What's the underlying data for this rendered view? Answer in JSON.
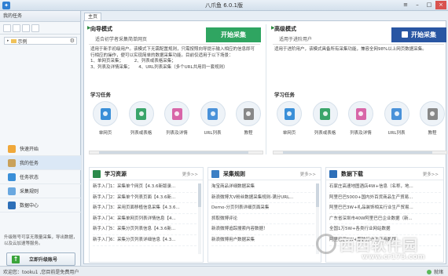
{
  "window": {
    "title": "八爪鱼 6.0.1版"
  },
  "sidebar": {
    "header": "我的任务",
    "tree_item": "示例",
    "nav": [
      {
        "label": "快速开始",
        "color": "#f0a83a"
      },
      {
        "label": "我的任务",
        "color": "#c9a15a"
      },
      {
        "label": "任务状态",
        "color": "#3a8fd8"
      },
      {
        "label": "采集规则",
        "color": "#6aa8e0"
      },
      {
        "label": "数据中心",
        "color": "#2d6fb8"
      }
    ],
    "note": "升级账号可享无限量采集，导出数据，以及云加速等服务。",
    "upgrade_label": "立即升级账号"
  },
  "tabs": {
    "home": "主页"
  },
  "guide": {
    "title": "向导模式",
    "subtitle": "适合初学者采集简单网页",
    "start": "开始采集",
    "desc_lines": [
      "适用于新手初级用户。该模式下无需配置规则，只需按照向导提示输入相应的信息即可",
      "行相应的操作，便可以实现简单的数据采集功能。目前仅适用于以下场景：",
      "1、单网页采集；　　　2、列表或表格采集；",
      "3、列表及详情采集；　　4、URL列表采集（多个URL共用同一套规则）"
    ],
    "tasks_title": "学习任务",
    "tasks": [
      {
        "label": "单网页",
        "color": "#3a8fd8"
      },
      {
        "label": "列表或表格",
        "color": "#3aa56a"
      },
      {
        "label": "列表及详情",
        "color": "#d866a8"
      },
      {
        "label": "URL列表",
        "color": "#4a92d9"
      },
      {
        "label": "教程",
        "color": "#888888"
      }
    ]
  },
  "advanced": {
    "title": "高级模式",
    "subtitle": "适用于进阶用户",
    "start": "开始采集",
    "desc": "适用于进阶用户，该模式具备所有采集功能，兼容全网98%以上网页数据采集。",
    "tasks_title": "学习任务",
    "tasks": [
      {
        "label": "单网页",
        "color": "#3a8fd8"
      },
      {
        "label": "列表或表格",
        "color": "#3aa56a"
      },
      {
        "label": "列表及详情",
        "color": "#d866a8"
      },
      {
        "label": "URL列表",
        "color": "#4a92d9"
      },
      {
        "label": "教程",
        "color": "#888888"
      }
    ]
  },
  "panels": {
    "learn": {
      "title": "学习资源",
      "more": "更多>>",
      "items": [
        "新手入门1：采集单个网页【4.3.6新版录...",
        "新手入门2：采集单个列表页面【4.3.6新...",
        "新手入门3：采用页面移植信息采集【4.3.6...",
        "新手入门4：采集单网页列表详情信息【4...",
        "新手入门5：采集分页列表信息【4.3.6新...",
        "新手入门6：采集分页列表详细信息【4.3..."
      ]
    },
    "rules": {
      "title": "采集规则",
      "more": "更多>>",
      "items": [
        "淘宝商品详细数据采集",
        "新浪微博大V粉丝数据采集规则-满分URL...",
        "Demo-分页列表详细页面采集",
        "抓取微博评论",
        "新浪微博追踪搜索内容数据！",
        "新浪微博用户数据采集"
      ]
    },
    "downloads": {
      "title": "数据下载",
      "more": "更多>>",
      "items": [
        "石家庄高速地图酒店4W+信息（名称，地...",
        "阿里巴巴5000+国内外百货商品生产贸易...",
        "阿里巴巴3W+礼品装饰相关行业生产贸易...",
        "广东省深圳市40W阿里巴巴企业数据（新...",
        "全国1万5W+各类行业网站数据",
        "阿里巴巴5W+服装行业生产商数据"
      ]
    }
  },
  "status": {
    "text": "欢迎您：tooku1 ,您目前是免费用户",
    "right": "就绪"
  },
  "watermark": {
    "text": "西西软件园",
    "url": "www.cr173.com"
  }
}
